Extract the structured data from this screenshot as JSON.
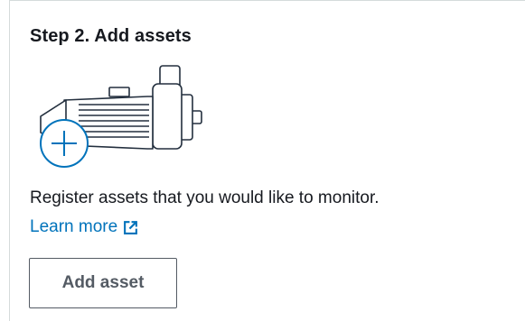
{
  "card": {
    "title": "Step 2. Add assets",
    "illustration_icon": "motor-with-plus-icon",
    "description": "Register assets that you would like to monitor.",
    "learn_more_label": "Learn more",
    "learn_more_icon": "external-link-icon",
    "add_button_label": "Add asset"
  },
  "colors": {
    "link": "#0073bb",
    "text": "#16191f",
    "button_border": "#545b64",
    "illustration_stroke": "#232f3e",
    "plus_circle": "#0073bb"
  }
}
